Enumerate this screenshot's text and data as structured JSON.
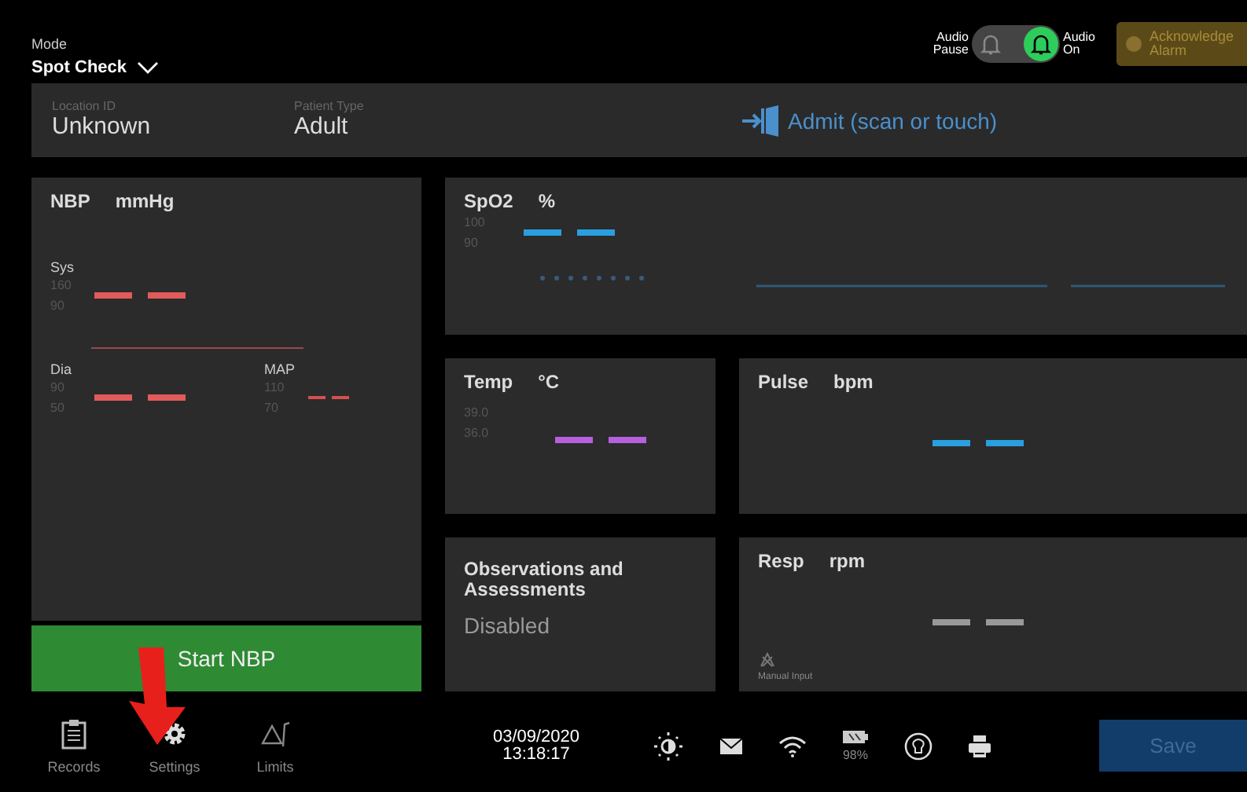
{
  "mode": {
    "label": "Mode",
    "value": "Spot Check"
  },
  "audio": {
    "pause_label": "Audio Pause",
    "on_label": "Audio On",
    "on": true
  },
  "acknowledge_button": "Acknowledge Alarm",
  "patient": {
    "fields": [
      {
        "label": "Location ID",
        "value": "Unknown"
      },
      {
        "label": "Patient Type",
        "value": "Adult"
      }
    ],
    "admit": "Admit (scan or touch)"
  },
  "nbp": {
    "title": "NBP",
    "unit": "mmHg",
    "groups": [
      {
        "label": "Sys",
        "limits": [
          "160",
          "90"
        ]
      },
      {
        "label": "Dia",
        "limits": [
          "90",
          "50"
        ]
      },
      {
        "label": "MAP",
        "limits": [
          "110",
          "70"
        ]
      }
    ],
    "button": "Start NBP"
  },
  "spo2": {
    "title": "SpO2",
    "unit": "%",
    "limits": [
      "100",
      "90"
    ]
  },
  "temp": {
    "title": "Temp",
    "unit": "°C",
    "limits": [
      "39.0",
      "36.0"
    ]
  },
  "pulse": {
    "title": "Pulse",
    "unit": "bpm"
  },
  "observations": {
    "title": "Observations and Assessments",
    "status": "Disabled"
  },
  "resp": {
    "title": "Resp",
    "unit": "rpm",
    "manual_input": "Manual Input"
  },
  "nav": [
    {
      "kind": "records",
      "label": "Records"
    },
    {
      "kind": "settings",
      "label": "Settings"
    },
    {
      "kind": "limits",
      "label": "Limits"
    }
  ],
  "date": "03/09/2020",
  "time": "13:18:17",
  "battery": "98%",
  "save_button": "Save"
}
